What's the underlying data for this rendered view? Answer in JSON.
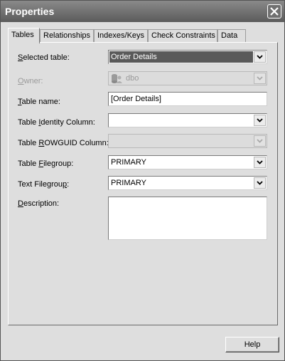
{
  "window": {
    "title": "Properties",
    "colors": {
      "titlebar": "#6e6e6e",
      "selection": "#5a5a5a",
      "face": "#dedede"
    }
  },
  "tabs": [
    {
      "label": "Tables",
      "active": true
    },
    {
      "label": "Relationships",
      "active": false
    },
    {
      "label": "Indexes/Keys",
      "active": false
    },
    {
      "label": "Check Constraints",
      "active": false
    },
    {
      "label": "Data",
      "active": false
    }
  ],
  "form": {
    "selected_table": {
      "label_pre": "",
      "label_key": "S",
      "label_post": "elected table:",
      "value": "Order Details"
    },
    "owner": {
      "label_pre": "",
      "label_key": "O",
      "label_post": "wner:",
      "value": "dbo",
      "icon": "database-owner-icon"
    },
    "table_name": {
      "label_pre": "",
      "label_key": "T",
      "label_post": "able name:",
      "value": "[Order Details]"
    },
    "identity_column": {
      "label_pre": "Table ",
      "label_key": "I",
      "label_post": "dentity Column:",
      "value": ""
    },
    "rowguid_column": {
      "label_pre": "Table ",
      "label_key": "R",
      "label_post": "OWGUID Column:",
      "value": ""
    },
    "table_filegroup": {
      "label_pre": "Table ",
      "label_key": "F",
      "label_post": "ilegroup:",
      "value": "PRIMARY"
    },
    "text_filegroup": {
      "label_pre": "Text Filegrou",
      "label_key": "p",
      "label_post": ":",
      "value": "PRIMARY"
    },
    "description": {
      "label_pre": "",
      "label_key": "D",
      "label_post": "escription:",
      "value": ""
    }
  },
  "buttons": {
    "help": "Help"
  }
}
